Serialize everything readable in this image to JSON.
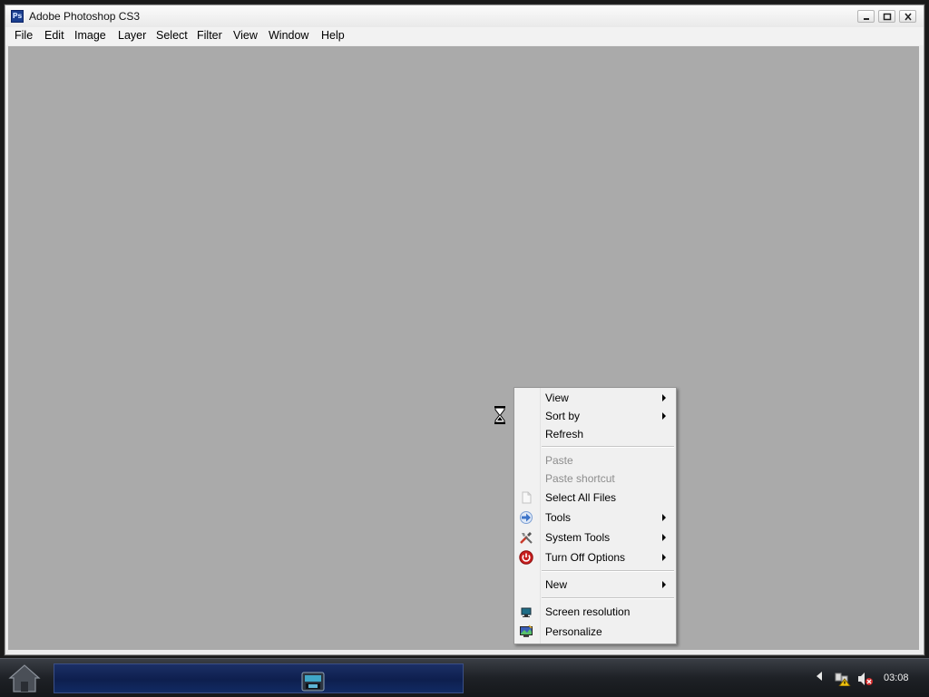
{
  "window": {
    "title": "Adobe Photoshop CS3",
    "app_icon_text": "Ps",
    "menu": [
      "File",
      "Edit",
      "Image",
      "Layer",
      "Select",
      "Filter",
      "View",
      "Window",
      "Help"
    ],
    "workspace_color": "#aaaaaa"
  },
  "context_menu": {
    "items": [
      {
        "label": "View",
        "submenu": true
      },
      {
        "label": "Sort by",
        "submenu": true
      },
      {
        "label": "Refresh"
      },
      {
        "label": "Paste",
        "disabled": true
      },
      {
        "label": "Paste shortcut",
        "disabled": true
      },
      {
        "label": "Select All Files",
        "icon": "blank-document-icon"
      },
      {
        "label": "Tools",
        "icon": "blue-arrow-icon",
        "submenu": true
      },
      {
        "label": "System Tools",
        "icon": "tools-icon",
        "submenu": true
      },
      {
        "label": "Turn Off Options",
        "icon": "power-icon",
        "submenu": true
      },
      {
        "label": "New",
        "submenu": true
      },
      {
        "label": "Screen resolution",
        "icon": "monitor-icon"
      },
      {
        "label": "Personalize",
        "icon": "personalize-icon"
      }
    ]
  },
  "taskbar": {
    "clock": "03:08",
    "start_icon": "home-icon",
    "task_button_icon": "photoshop-taskbar-icon",
    "tray_icons": [
      "show-hidden-icons-chevron",
      "network-warning-icon",
      "volume-muted-icon"
    ]
  }
}
